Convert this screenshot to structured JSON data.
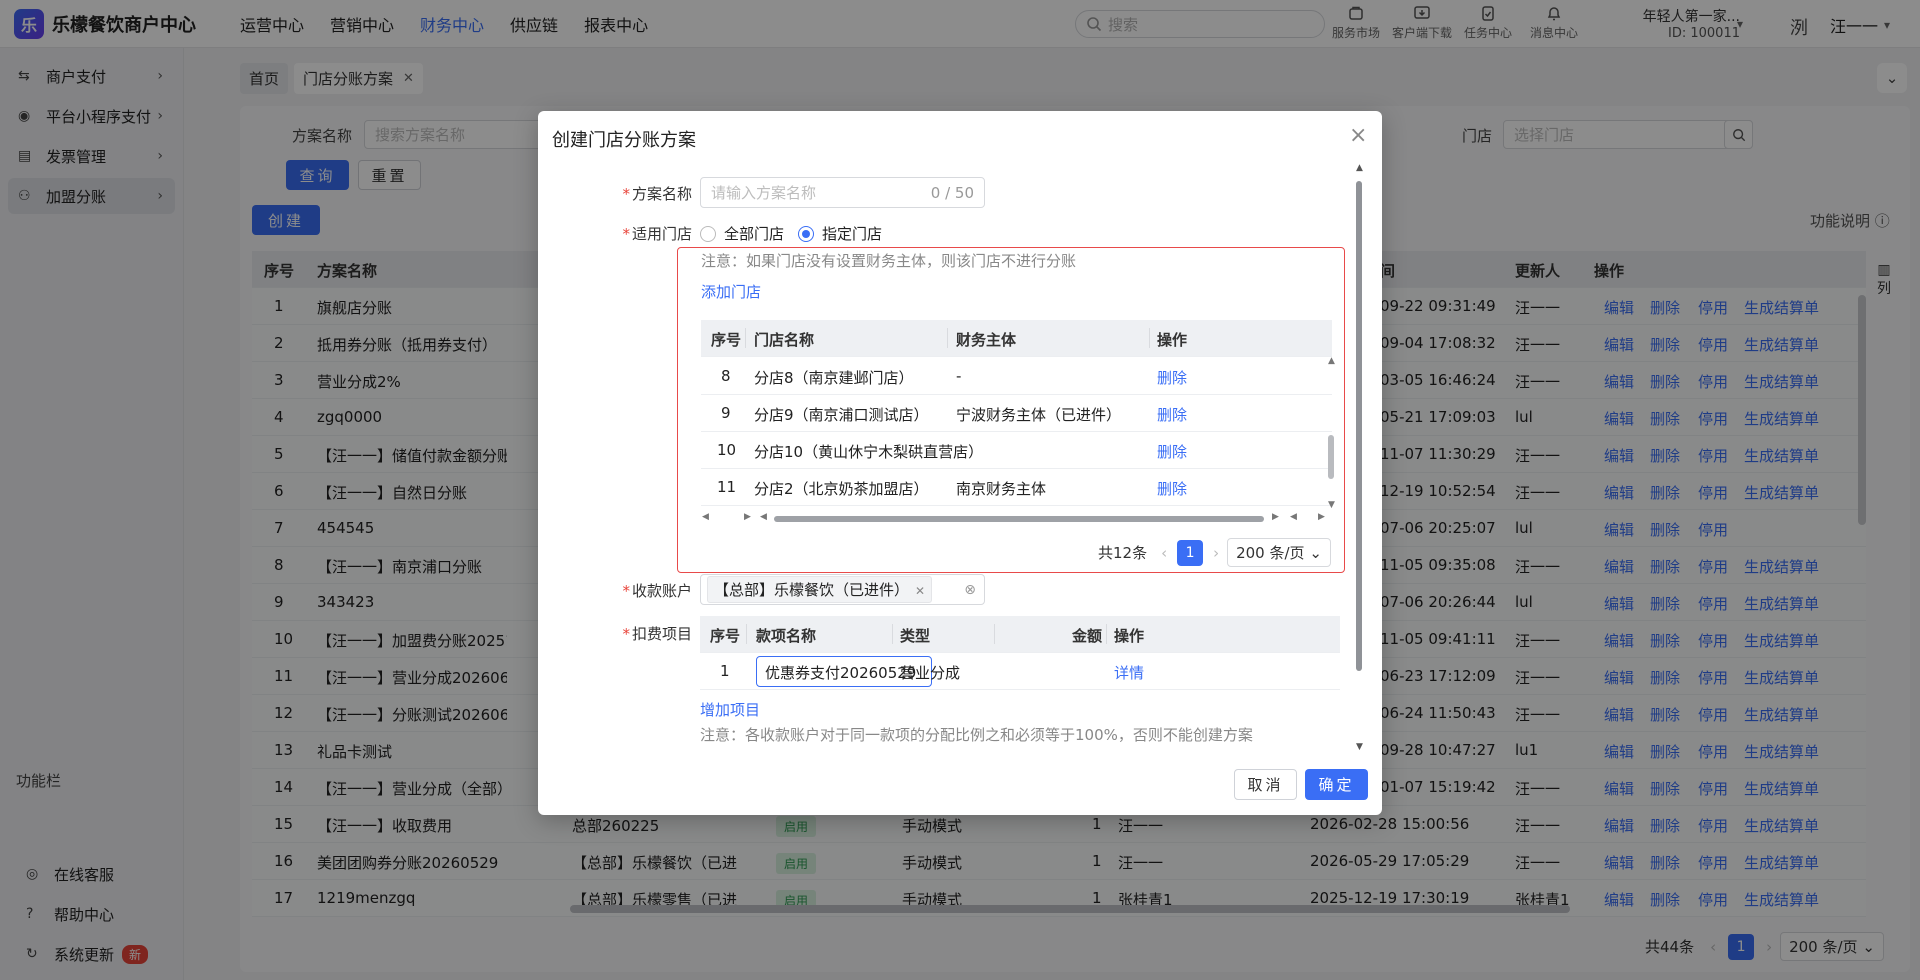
{
  "brand": {
    "title": "乐檬餐饮商户中心",
    "logo_letter": "乐"
  },
  "topnav": [
    "运营中心",
    "营销中心",
    "财务中心",
    "供应链",
    "报表中心"
  ],
  "topnav_active": "财务中心",
  "search": {
    "placeholder": "搜索"
  },
  "tools": [
    {
      "label": "服务市场",
      "icon": "bag-icon"
    },
    {
      "label": "客户端下载",
      "icon": "download-icon"
    },
    {
      "label": "任务中心",
      "icon": "clipboard-icon"
    },
    {
      "label": "消息中心",
      "icon": "bell-icon"
    }
  ],
  "account": {
    "name": "年轻人第一家...",
    "id": "ID: 100011"
  },
  "user": {
    "name": "汪一一",
    "avatar_text": "洌"
  },
  "sidebar": {
    "items": [
      {
        "label": "商户支付",
        "icon": "swap-icon"
      },
      {
        "label": "平台小程序支付",
        "icon": "miniapp-icon"
      },
      {
        "label": "发票管理",
        "icon": "invoice-icon"
      },
      {
        "label": "加盟分账",
        "icon": "user-plus-icon",
        "active": true
      }
    ],
    "section_label": "功能栏",
    "bottom": [
      {
        "label": "在线客服",
        "icon": "headset-icon"
      },
      {
        "label": "帮助中心",
        "icon": "help-icon"
      },
      {
        "label": "系统更新",
        "icon": "refresh-icon",
        "badge": "新"
      }
    ]
  },
  "tabs": [
    {
      "label": "首页"
    },
    {
      "label": "门店分账方案",
      "active": true
    }
  ],
  "filters": {
    "name_label": "方案名称",
    "name_placeholder": "搜索方案名称",
    "store_label": "门店",
    "store_placeholder": "选择门店",
    "query_btn": "查询",
    "reset_btn": "重置",
    "create_btn": "创建",
    "help": "功能说明",
    "col_setting": "列"
  },
  "table": {
    "headers": {
      "no": "序号",
      "name": "方案名称",
      "time": "间",
      "updater": "更新人",
      "ops": "操作"
    },
    "rows": [
      {
        "no": "1",
        "name": "旗舰店分账",
        "time": "09-22 09:31:49",
        "updater": "汪一一",
        "gen": true
      },
      {
        "no": "2",
        "name": "抵用券分账（抵用券支付）",
        "time": "09-04 17:08:32",
        "updater": "汪一一",
        "gen": true
      },
      {
        "no": "3",
        "name": "营业分成2%",
        "time": "03-05 16:46:24",
        "updater": "汪一一",
        "gen": true
      },
      {
        "no": "4",
        "name": "zgq0000",
        "time": "05-21 17:09:03",
        "updater": "lul",
        "gen": true
      },
      {
        "no": "5",
        "name": "【汪一一】储值付款金额分账",
        "time": "11-07 11:30:29",
        "updater": "汪一一",
        "gen": true
      },
      {
        "no": "6",
        "name": "【汪一一】自然日分账",
        "time": "12-19 10:52:54",
        "updater": "汪一一",
        "gen": true
      },
      {
        "no": "7",
        "name": "454545",
        "time": "07-06 20:25:07",
        "updater": "lul",
        "gen": false
      },
      {
        "no": "8",
        "name": "【汪一一】南京浦口分账",
        "time": "11-05 09:35:08",
        "updater": "汪一一",
        "gen": true
      },
      {
        "no": "9",
        "name": "343423",
        "time": "07-06 20:26:44",
        "updater": "lul",
        "gen": true
      },
      {
        "no": "10",
        "name": "【汪一一】加盟费分账2025110",
        "time": "11-05 09:41:11",
        "updater": "汪一一",
        "gen": true
      },
      {
        "no": "11",
        "name": "【汪一一】营业分成20260623",
        "time": "06-23 17:12:09",
        "updater": "汪一一",
        "gen": true
      },
      {
        "no": "12",
        "name": "【汪一一】分账测试20260624",
        "time": "06-24 11:50:43",
        "updater": "汪一一",
        "gen": true
      },
      {
        "no": "13",
        "name": "礼品卡测试",
        "time": "09-28 10:47:27",
        "updater": "lu1",
        "gen": true
      },
      {
        "no": "14",
        "name": "【汪一一】营业分成（全部）",
        "time": "01-07 15:19:42",
        "updater": "汪一一",
        "gen": true
      },
      {
        "no": "15",
        "name": "【汪一一】收取费用",
        "account": "总部260225",
        "status": "启用",
        "mode": "手动模式",
        "count": "1",
        "creator": "汪一一",
        "time": "2026-02-28 15:00:56",
        "updater": "汪一一",
        "gen": true
      },
      {
        "no": "16",
        "name": "美团团购券分账20260529",
        "account": "【总部】乐檬餐饮（已进",
        "status": "启用",
        "mode": "手动模式",
        "count": "1",
        "creator": "汪一一",
        "time": "2026-05-29 17:05:29",
        "updater": "汪一一",
        "gen": true
      },
      {
        "no": "17",
        "name": "1219menzgq",
        "account": "【总部】乐檬零售（已进",
        "status": "启用",
        "mode": "手动模式",
        "count": "1",
        "creator": "张桂青1",
        "time": "2025-12-19 17:30:19",
        "updater": "张桂青1",
        "gen": true
      }
    ],
    "ops": {
      "edit": "编辑",
      "delete": "删除",
      "disable": "停用",
      "gen": "生成结算单"
    }
  },
  "pager": {
    "total": "共44条",
    "page": "1",
    "size": "200 条/页"
  },
  "modal": {
    "title": "创建门店分账方案",
    "name_label": "方案名称",
    "name_placeholder": "请输入方案名称",
    "name_count": "0 / 50",
    "store_label": "适用门店",
    "radio_all": "全部门店",
    "radio_specific": "指定门店",
    "store_note": "注意：如果门店没有设置财务主体，则该门店不进行分账",
    "add_store": "添加门店",
    "store_table": {
      "headers": {
        "no": "序号",
        "name": "门店名称",
        "entity": "财务主体",
        "op": "操作"
      },
      "rows": [
        {
          "no": "8",
          "name": "分店8（南京建邺门店）",
          "entity": "-",
          "op": "删除"
        },
        {
          "no": "9",
          "name": "分店9（南京浦口测试店）",
          "entity": "宁波财务主体（已进件）",
          "op": "删除"
        },
        {
          "no": "10",
          "name": "分店10（黄山休宁木梨硔直营店）",
          "entity": "-",
          "op": "删除"
        },
        {
          "no": "11",
          "name": "分店2（北京奶茶加盟店）",
          "entity": "南京财务主体",
          "op": "删除"
        }
      ]
    },
    "store_pager": {
      "total": "共12条",
      "page": "1",
      "size": "200 条/页"
    },
    "account_label": "收款账户",
    "account_value": "【总部】乐檬餐饮（已进件）",
    "fee_label": "扣费项目",
    "fee_table": {
      "headers": {
        "no": "序号",
        "name": "款项名称",
        "type": "类型",
        "amount": "金额",
        "op": "操作"
      },
      "rows": [
        {
          "no": "1",
          "name": "优惠券支付20260529",
          "type": "营业分成",
          "op": "详情"
        }
      ]
    },
    "add_fee": "增加项目",
    "fee_note": "注意：各收款账户对于同一款项的分配比例之和必须等于100%，否则不能创建方案",
    "cancel": "取消",
    "confirm": "确定"
  },
  "colors": {
    "primary": "#3a6ef5",
    "danger": "#e84a4a",
    "tag_green": "#2e9c53"
  }
}
